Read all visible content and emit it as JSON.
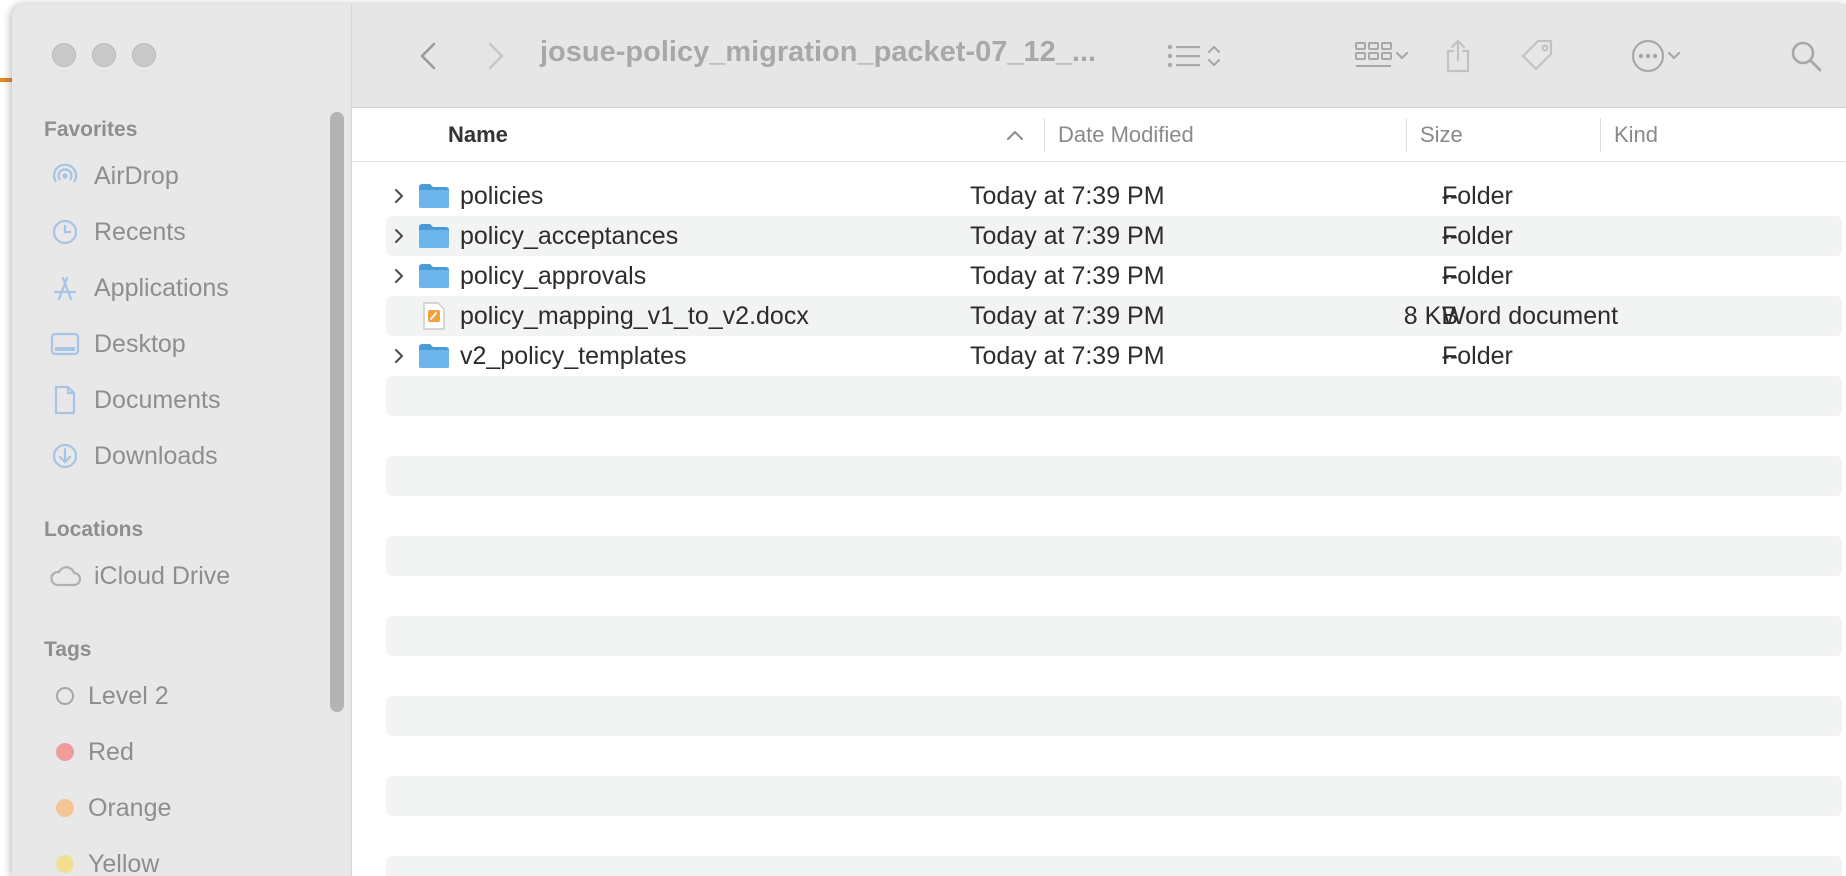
{
  "window": {
    "title": "josue-policy_migration_packet-07_12_...",
    "traffic_lights": [
      "close",
      "minimize",
      "zoom"
    ]
  },
  "sidebar": {
    "favorites_label": "Favorites",
    "favorites": [
      {
        "label": "AirDrop",
        "icon": "airdrop-icon"
      },
      {
        "label": "Recents",
        "icon": "clock-icon"
      },
      {
        "label": "Applications",
        "icon": "applications-icon"
      },
      {
        "label": "Desktop",
        "icon": "desktop-icon"
      },
      {
        "label": "Documents",
        "icon": "document-icon"
      },
      {
        "label": "Downloads",
        "icon": "download-icon"
      }
    ],
    "locations_label": "Locations",
    "locations": [
      {
        "label": "iCloud Drive",
        "icon": "cloud-icon"
      }
    ],
    "tags_label": "Tags",
    "tags": [
      {
        "label": "Level 2",
        "color": ""
      },
      {
        "label": "Red",
        "color": "#f19b9b"
      },
      {
        "label": "Orange",
        "color": "#f3c595"
      },
      {
        "label": "Yellow",
        "color": "#f2df94"
      }
    ]
  },
  "columns": {
    "name": "Name",
    "date": "Date Modified",
    "size": "Size",
    "kind": "Kind"
  },
  "files": [
    {
      "name": "policies",
      "type": "folder",
      "date": "Today at 7:39 PM",
      "size": "--",
      "kind": "Folder"
    },
    {
      "name": "policy_acceptances",
      "type": "folder",
      "date": "Today at 7:39 PM",
      "size": "--",
      "kind": "Folder"
    },
    {
      "name": "policy_approvals",
      "type": "folder",
      "date": "Today at 7:39 PM",
      "size": "--",
      "kind": "Folder"
    },
    {
      "name": "policy_mapping_v1_to_v2.docx",
      "type": "docx",
      "date": "Today at 7:39 PM",
      "size": "8 KB",
      "kind": "Word document"
    },
    {
      "name": "v2_policy_templates",
      "type": "folder",
      "date": "Today at 7:39 PM",
      "size": "--",
      "kind": "Folder"
    }
  ],
  "colors": {
    "folder": "#6cb6ec",
    "folder_dark": "#4a9ad9",
    "sidebar_icon": "#a5c4e6"
  }
}
